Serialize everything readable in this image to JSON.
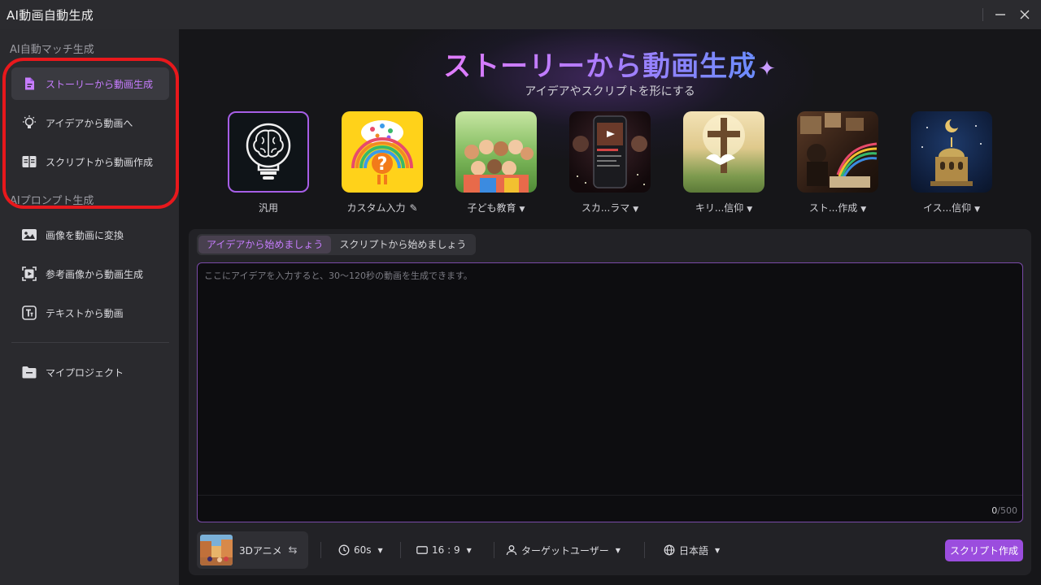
{
  "window": {
    "title": "AI動画自動生成",
    "minimize_glyph": "—",
    "close_glyph": "✕"
  },
  "sidebar": {
    "groups": [
      {
        "title": "AI自動マッチ生成",
        "items": [
          {
            "label": "ストーリーから動画生成",
            "icon": "document-icon",
            "active": true
          },
          {
            "label": "アイデアから動画へ",
            "icon": "lightbulb-icon",
            "active": false
          },
          {
            "label": "スクリプトから動画作成",
            "icon": "book-icon",
            "active": false
          }
        ]
      },
      {
        "title": "AIプロンプト生成",
        "items": [
          {
            "label": "画像を動画に変換",
            "icon": "image-icon",
            "active": false
          },
          {
            "label": "参考画像から動画生成",
            "icon": "play-frame-icon",
            "active": false
          },
          {
            "label": "テキストから動画",
            "icon": "text-icon",
            "active": false
          }
        ]
      }
    ],
    "project": {
      "label": "マイプロジェクト",
      "icon": "folder-icon"
    }
  },
  "hero": {
    "title": "ストーリーから動画生成",
    "title_icon": "magic-wand-icon",
    "subtitle": "アイデアやスクリプトを形にする"
  },
  "templates": [
    {
      "label": "汎用",
      "selected": true,
      "has_dropdown": false
    },
    {
      "label": "カスタム入力",
      "selected": false,
      "has_dropdown": false,
      "has_edit_icon": true
    },
    {
      "label": "子ども教育",
      "selected": false,
      "has_dropdown": true
    },
    {
      "label": "スカ...ラマ",
      "selected": false,
      "has_dropdown": true
    },
    {
      "label": "キリ...信仰",
      "selected": false,
      "has_dropdown": true
    },
    {
      "label": "スト...作成",
      "selected": false,
      "has_dropdown": true
    },
    {
      "label": "イス...信仰",
      "selected": false,
      "has_dropdown": true
    }
  ],
  "editor": {
    "tabs": [
      {
        "label": "アイデアから始めましょう",
        "active": true
      },
      {
        "label": "スクリプトから始めましょう",
        "active": false
      }
    ],
    "placeholder": "ここにアイデアを入力すると、30〜120秒の動画を生成できます。",
    "counter_current": "0",
    "counter_max": "/500"
  },
  "toolbar": {
    "style_label": "3Dアニメ",
    "duration": "60s",
    "aspect_ratio": "16 : 9",
    "audience": "ターゲットユーザー",
    "language": "日本語",
    "cta_label": "スクリプト作成"
  },
  "colors": {
    "accent": "#c77dff",
    "cta": "#9b4dde",
    "highlight_ring": "#e8181c"
  }
}
